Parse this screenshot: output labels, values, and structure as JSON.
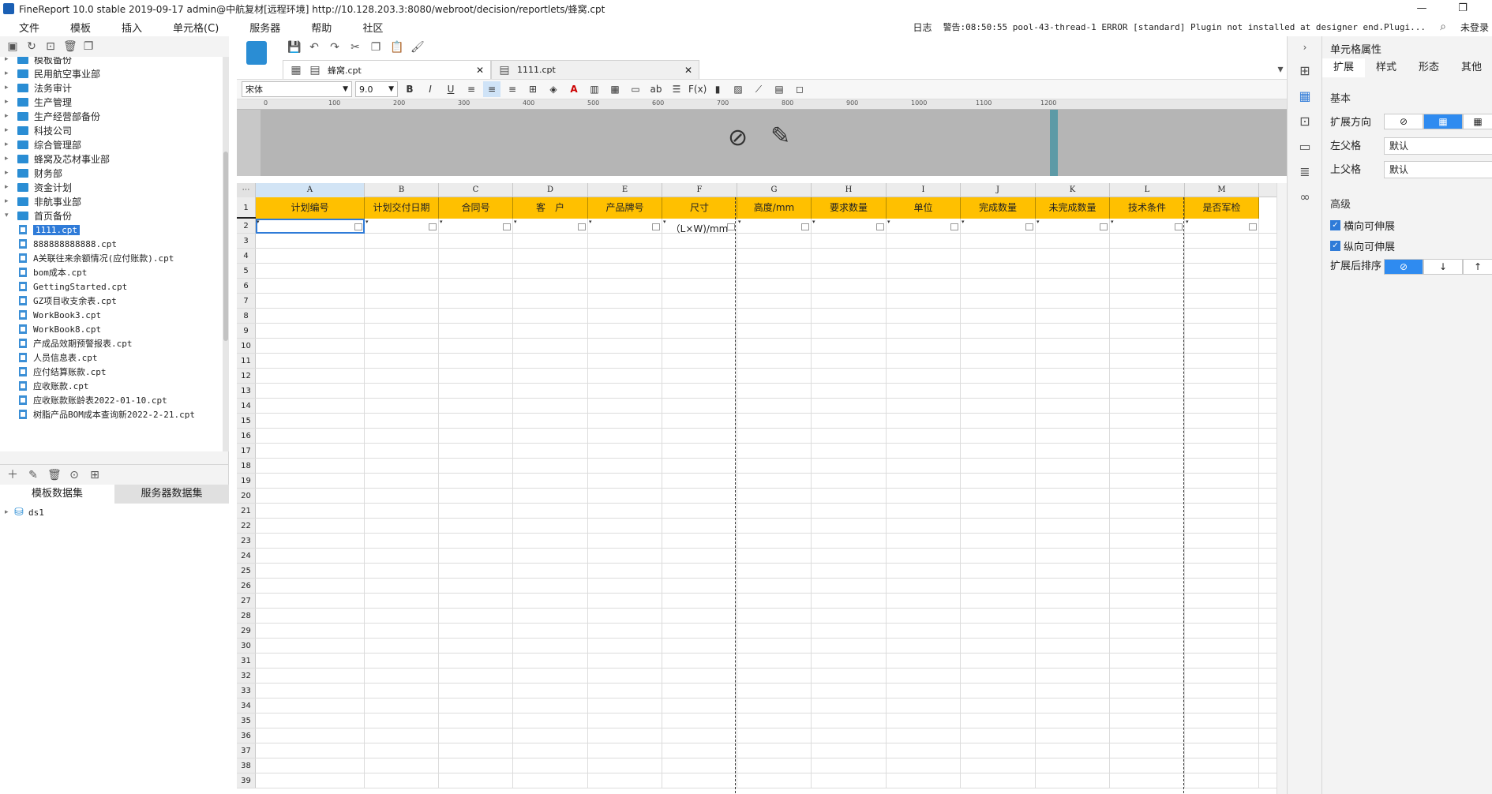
{
  "window": {
    "title": "FineReport 10.0 stable 2019-09-17 admin@中航复材[远程环境]   http://10.128.203.3:8080/webroot/decision/reportlets/蜂窝.cpt",
    "minimize": "—",
    "restore": "❐"
  },
  "menu": {
    "items": [
      "文件",
      "模板",
      "插入",
      "单元格(C)",
      "服务器",
      "帮助",
      "社区"
    ],
    "log": "日志",
    "warning": "警告:08:50:55 pool-43-thread-1 ERROR [standard] Plugin not installed at designer end.Plugi...",
    "login": "未登录"
  },
  "tree": {
    "folders": [
      "模板备份",
      "民用航空事业部",
      "法务审计",
      "生产管理",
      "生产经营部备份",
      "科技公司",
      "综合管理部",
      "蜂窝及芯材事业部",
      "财务部",
      "资金计划",
      "非航事业部",
      "首页备份"
    ],
    "files": [
      "1111.cpt",
      "888888888888.cpt",
      "A关联往来余额情况(应付账款).cpt",
      "bom成本.cpt",
      "GettingStarted.cpt",
      "GZ项目收支余表.cpt",
      "WorkBook3.cpt",
      "WorkBook8.cpt",
      "产成品效期预警报表.cpt",
      "人员信息表.cpt",
      "应付结算账款.cpt",
      "应收账款.cpt",
      "应收账款账龄表2022-01-10.cpt",
      "树脂产品BOM成本查询新2022-2-21.cpt"
    ],
    "selected": "1111.cpt"
  },
  "datasets": {
    "tab_template": "模板数据集",
    "tab_server": "服务器数据集",
    "items": [
      "ds1"
    ]
  },
  "tabs": [
    {
      "label": "蜂窝.cpt",
      "active": true
    },
    {
      "label": "1111.cpt",
      "active": false
    }
  ],
  "format": {
    "font": "宋体",
    "size": "9.0",
    "fx": "F(x)"
  },
  "ruler": [
    "0",
    "100",
    "200",
    "300",
    "400",
    "500",
    "600",
    "700",
    "800",
    "900",
    "1000",
    "1100",
    "1200"
  ],
  "grid": {
    "columns": [
      "A",
      "B",
      "C",
      "D",
      "E",
      "F",
      "G",
      "H",
      "I",
      "J",
      "K",
      "L",
      "M"
    ],
    "headers": [
      "计划编号",
      "计划交付日期",
      "合同号",
      "客　户",
      "产品牌号",
      "尺寸（L×W)/mm",
      "高度/mm",
      "要求数量",
      "单位",
      "完成数量",
      "未完成数量",
      "技术条件",
      "是否军检"
    ],
    "row_numbers": [
      "1",
      "2",
      "3",
      "4",
      "5",
      "6",
      "7",
      "8",
      "9",
      "10",
      "11",
      "12",
      "13",
      "14",
      "15",
      "16",
      "17",
      "18",
      "19",
      "20",
      "21",
      "22",
      "23",
      "24",
      "25",
      "26",
      "27",
      "28",
      "29",
      "30",
      "31",
      "32",
      "33",
      "34",
      "35",
      "36",
      "37",
      "38",
      "39"
    ]
  },
  "props": {
    "title": "单元格属性",
    "tabs": [
      "扩展",
      "样式",
      "形态",
      "其他"
    ],
    "section_basic": "基本",
    "expand_dir": "扩展方向",
    "left_parent": "左父格",
    "top_parent": "上父格",
    "left_parent_value": "默认",
    "top_parent_value": "默认",
    "section_adv": "高级",
    "h_expand": "横向可伸展",
    "v_expand": "纵向可伸展",
    "sort_after": "扩展后排序"
  },
  "colors": {
    "header_fill": "#ffc000",
    "accent": "#2f7bd8"
  }
}
